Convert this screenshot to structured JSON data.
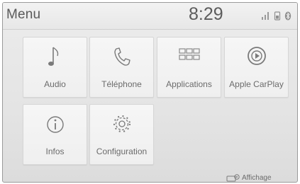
{
  "header": {
    "title": "Menu",
    "clock": "8:29",
    "status_icons": [
      "signal-bars-icon",
      "phone-battery-icon",
      "bluetooth-icon"
    ]
  },
  "tiles": [
    {
      "label": "Audio",
      "icon": "music-note-icon"
    },
    {
      "label": "Téléphone",
      "icon": "phone-handset-icon"
    },
    {
      "label": "Applications",
      "icon": "app-grid-icon"
    },
    {
      "label": "Apple CarPlay",
      "icon": "carplay-play-icon"
    },
    {
      "label": "Infos",
      "icon": "info-icon"
    },
    {
      "label": "Configuration",
      "icon": "gear-icon"
    }
  ],
  "footer": {
    "display_label": "Affichage",
    "display_icon": "display-settings-icon"
  },
  "colors": {
    "background": "#e7e7e7",
    "tile": "#f3f3f3",
    "text": "#6b6b6b",
    "icon": "#7a7a7a"
  }
}
